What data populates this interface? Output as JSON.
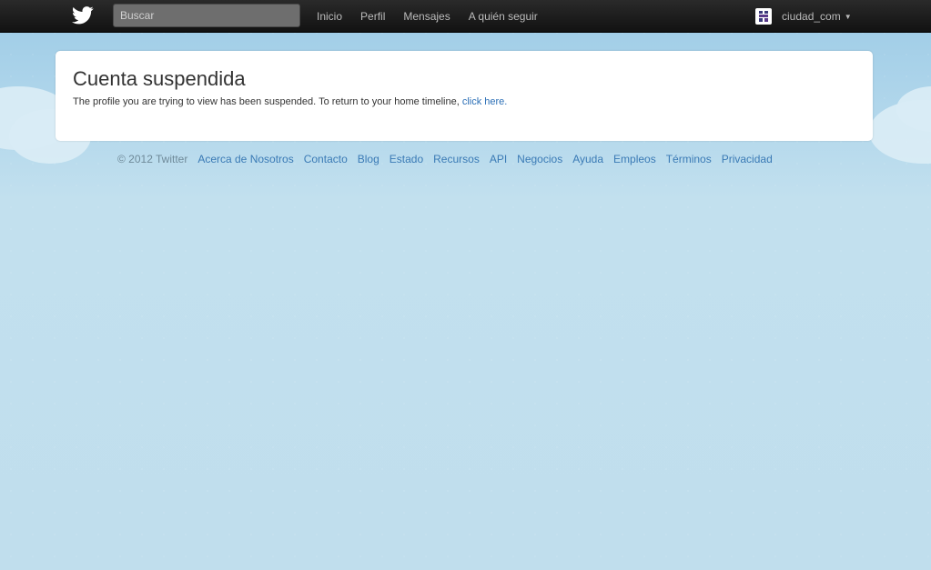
{
  "topbar": {
    "search_placeholder": "Buscar",
    "nav": [
      {
        "label": "Inicio"
      },
      {
        "label": "Perfil"
      },
      {
        "label": "Mensajes"
      },
      {
        "label": "A quién seguir"
      }
    ],
    "username": "ciudad_com",
    "caret_icon": "caret-down-icon",
    "logo_icon": "twitter-bird-icon"
  },
  "card": {
    "title": "Cuenta suspendida",
    "message": "The profile you are trying to view has been suspended. To return to your home timeline, ",
    "link": "click here."
  },
  "footer": {
    "copyright": "© 2012 Twitter",
    "links": [
      {
        "label": "Acerca de Nosotros"
      },
      {
        "label": "Contacto"
      },
      {
        "label": "Blog"
      },
      {
        "label": "Estado"
      },
      {
        "label": "Recursos"
      },
      {
        "label": "API"
      },
      {
        "label": "Negocios"
      },
      {
        "label": "Ayuda"
      },
      {
        "label": "Empleos"
      },
      {
        "label": "Términos"
      },
      {
        "label": "Privacidad"
      }
    ]
  },
  "colors": {
    "link": "#2b6fb6",
    "background": "#c0deed",
    "topbar": "#1b1b1b"
  }
}
